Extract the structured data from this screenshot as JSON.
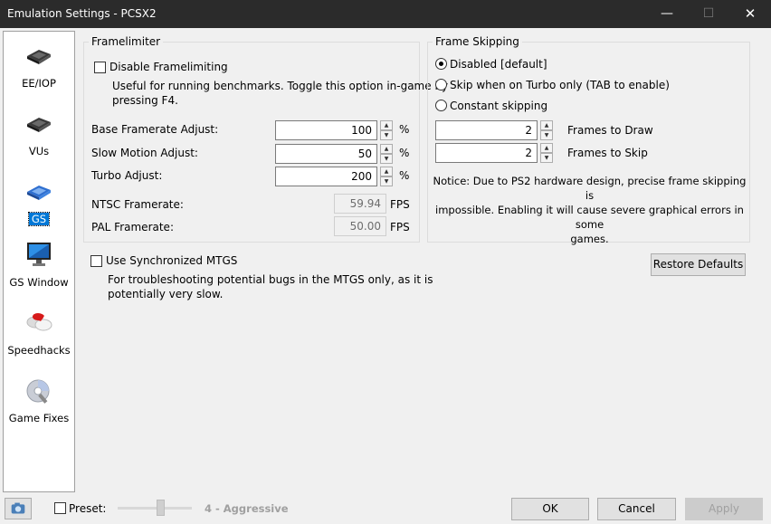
{
  "window": {
    "title": "Emulation Settings - PCSX2",
    "min_glyph": "—",
    "max_glyph": "☐",
    "close_glyph": "✕"
  },
  "sidebar": {
    "items": [
      {
        "label": "EE/IOP",
        "icon": "chip-icon"
      },
      {
        "label": "VUs",
        "icon": "chip-icon"
      },
      {
        "label": "GS",
        "icon": "gpu-chip-icon",
        "selected": true
      },
      {
        "label": "GS Window",
        "icon": "monitor-icon"
      },
      {
        "label": "Speedhacks",
        "icon": "pills-icon"
      },
      {
        "label": "Game Fixes",
        "icon": "disc-wrench-icon"
      }
    ]
  },
  "framelimiter": {
    "title": "Framelimiter",
    "disable_label": "Disable Framelimiting",
    "disable_checked": false,
    "disable_desc_1": "Useful for running benchmarks. Toggle this option in-game by",
    "disable_desc_2": "pressing F4.",
    "rows": [
      {
        "label": "Base Framerate Adjust:",
        "value": "100",
        "unit": "%"
      },
      {
        "label": "Slow Motion Adjust:",
        "value": "50",
        "unit": "%"
      },
      {
        "label": "Turbo Adjust:",
        "value": "200",
        "unit": "%"
      }
    ],
    "ntsc_label": "NTSC Framerate:",
    "ntsc_value": "59.94",
    "ntsc_unit": "FPS",
    "pal_label": "PAL Framerate:",
    "pal_value": "50.00",
    "pal_unit": "FPS"
  },
  "frame_skipping": {
    "title": "Frame Skipping",
    "options": [
      {
        "label": "Disabled [default]",
        "selected": true
      },
      {
        "label": "Skip when on Turbo only (TAB to enable)",
        "selected": false
      },
      {
        "label": "Constant skipping",
        "selected": false
      }
    ],
    "draw_value": "2",
    "draw_label": "Frames to Draw",
    "skip_value": "2",
    "skip_label": "Frames to Skip",
    "notice_1": "Notice: Due to PS2 hardware design, precise frame skipping is",
    "notice_2": "impossible. Enabling it will cause severe graphical errors in some",
    "notice_3": "games."
  },
  "mtgs": {
    "label": "Use Synchronized MTGS",
    "checked": false,
    "desc_1": "For troubleshooting potential bugs in the MTGS only, as it is",
    "desc_2": "potentially very slow."
  },
  "restore_defaults_label": "Restore Defaults",
  "footer": {
    "preset_label": "Preset:",
    "preset_checked": false,
    "preset_value": "4 - Aggressive",
    "ok_label": "OK",
    "cancel_label": "Cancel",
    "apply_label": "Apply"
  }
}
